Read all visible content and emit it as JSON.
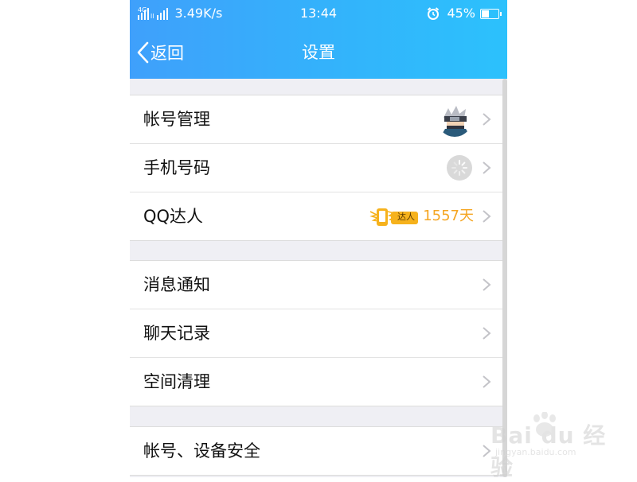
{
  "status_bar": {
    "network": "4G",
    "speed": "3.49K/s",
    "time": "13:44",
    "battery": "45%",
    "battery_level": 0.45
  },
  "header": {
    "back_label": "返回",
    "title": "设置",
    "gradient_start": "#3fa0fb",
    "gradient_end": "#2cc1fc"
  },
  "groups": [
    {
      "items": [
        {
          "label": "帐号管理",
          "icon": "avatar"
        },
        {
          "label": "手机号码",
          "icon": "loading-spinner"
        },
        {
          "label": "QQ达人",
          "badge_text": "达人",
          "days": "1557天"
        }
      ]
    },
    {
      "items": [
        {
          "label": "消息通知"
        },
        {
          "label": "聊天记录"
        },
        {
          "label": "空间清理"
        }
      ]
    },
    {
      "items": [
        {
          "label": "帐号、设备安全"
        }
      ]
    }
  ],
  "watermark": {
    "main": "Bai du 经验",
    "sub": "jingyan.baidu.com"
  },
  "colors": {
    "days_accent": "#f5a623",
    "badge": "#f6b21c",
    "background": "#efeff4"
  }
}
